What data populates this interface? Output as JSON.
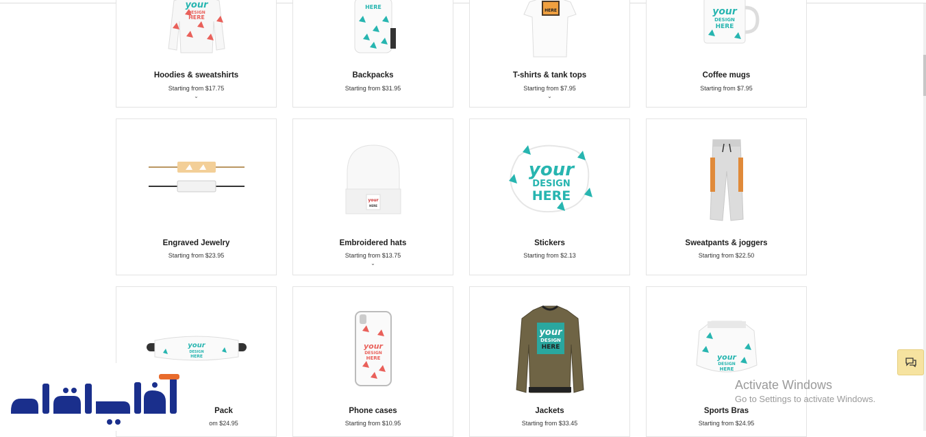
{
  "products": [
    {
      "name": "Hoodies & sweatshirts",
      "price": "Starting from $17.75",
      "chevron": "⌄"
    },
    {
      "name": "Backpacks",
      "price": "Starting from $31.95",
      "chevron": ""
    },
    {
      "name": "T-shirts & tank tops",
      "price": "Starting from $7.95",
      "chevron": "⌄"
    },
    {
      "name": "Coffee mugs",
      "price": "Starting from $7.95",
      "chevron": ""
    },
    {
      "name": "Engraved Jewelry",
      "price": "Starting from $23.95",
      "chevron": ""
    },
    {
      "name": "Embroidered hats",
      "price": "Starting from $13.75",
      "chevron": "⌄"
    },
    {
      "name": "Stickers",
      "price": "Starting from $2.13",
      "chevron": ""
    },
    {
      "name": "Sweatpants & joggers",
      "price": "Starting from $22.50",
      "chevron": ""
    },
    {
      "name": "Pack",
      "price": "om $24.95",
      "chevron": ""
    },
    {
      "name": "Phone cases",
      "price": "Starting from $10.95",
      "chevron": ""
    },
    {
      "name": "Jackets",
      "price": "Starting from $33.45",
      "chevron": ""
    },
    {
      "name": "Sports Bras",
      "price": "Starting from $24.95",
      "chevron": ""
    }
  ],
  "design_text": {
    "line1": "your",
    "line2": "DESIGN",
    "line3": "HERE"
  },
  "overlay": {
    "activate_title": "Activate Windows",
    "activate_sub": "Go to Settings to activate Windows.",
    "watermark": "أفكار باختصار"
  },
  "icons": {
    "chat": "chat-bubble-icon",
    "chevron": "chevron-down-icon"
  },
  "colors": {
    "teal": "#27b5b0",
    "coral": "#e9605a",
    "watermark": "#1a2f8c",
    "card_border": "#e3e3e3",
    "chat_bg": "#f6e3a0"
  }
}
